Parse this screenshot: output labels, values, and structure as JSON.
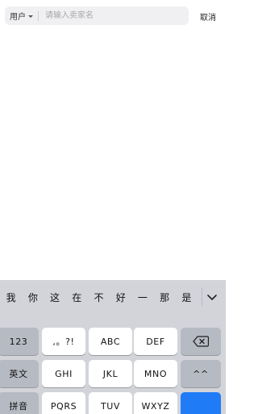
{
  "search": {
    "scope_label": "用户",
    "placeholder": "请输入卖家名",
    "cancel_label": "取消"
  },
  "keyboard": {
    "suggestions": [
      "我",
      "你",
      "这",
      "在",
      "不",
      "好",
      "一",
      "那",
      "是"
    ],
    "keys": {
      "numbers": "123",
      "punctuation": ",。?!",
      "abc": "ABC",
      "def": "DEF",
      "english": "英文",
      "ghi": "GHI",
      "jkl": "JKL",
      "mno": "MNO",
      "face": "^^",
      "pinyin": "拼音",
      "pqrs": "PQRS",
      "tuv": "TUV",
      "wxyz": "WXYZ"
    },
    "icons": {
      "collapse": "chevron-down-icon",
      "delete": "backspace-icon"
    },
    "colors": {
      "background": "#d2d4da",
      "function_key": "#b6bac3",
      "letter_key": "#ffffff",
      "enter_key": "#1f7cf6"
    }
  }
}
